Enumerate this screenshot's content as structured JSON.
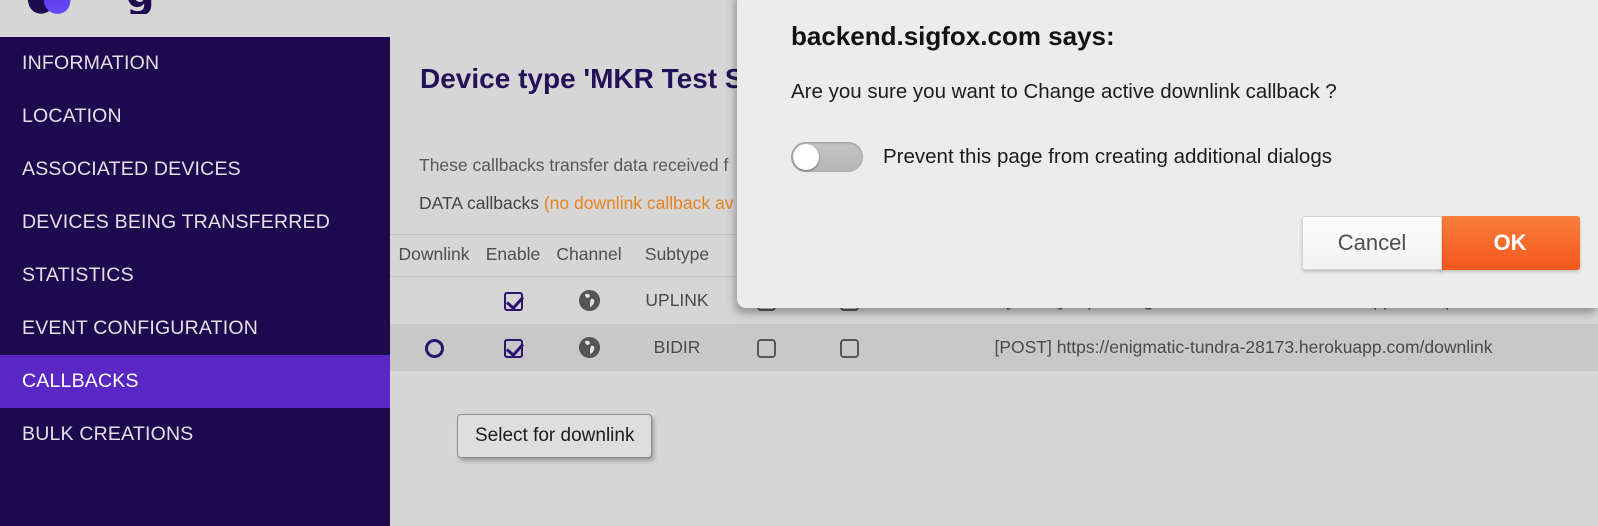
{
  "brand": {
    "logo_name": "sigfox-logo"
  },
  "sidebar": {
    "items": [
      {
        "label": "INFORMATION",
        "active": false
      },
      {
        "label": "LOCATION",
        "active": false
      },
      {
        "label": "ASSOCIATED DEVICES",
        "active": false
      },
      {
        "label": "DEVICES BEING TRANSFERRED",
        "active": false
      },
      {
        "label": "STATISTICS",
        "active": false
      },
      {
        "label": "EVENT CONFIGURATION",
        "active": false
      },
      {
        "label": "CALLBACKS",
        "active": true
      },
      {
        "label": "BULK CREATIONS",
        "active": false
      }
    ],
    "active_color": "#5b27c4",
    "background": "#1d0a4e"
  },
  "main": {
    "page_title": "Device type 'MKR Test S",
    "description_line1": "These callbacks transfer data received f",
    "description_line2_prefix": "DATA callbacks ",
    "description_line2_warning": "(no downlink callback av",
    "warning_color": "#e8831f",
    "table": {
      "headers": [
        "Downlink",
        "Enable",
        "Channel",
        "Subtype",
        "",
        "",
        ""
      ],
      "rows": [
        {
          "downlink": "",
          "downlink_type": "none",
          "enable_checked": true,
          "channel_icon": "globe-icon",
          "subtype": "UPLINK",
          "copy_checked": false,
          "edit_checked": false,
          "url": "[POST] https://enigmatic-tundra-28173.herokuapp.com/uplink",
          "highlight": false
        },
        {
          "downlink": "",
          "downlink_type": "radio",
          "enable_checked": true,
          "channel_icon": "globe-icon",
          "subtype": "BIDIR",
          "copy_checked": false,
          "edit_checked": false,
          "url": "[POST] https://enigmatic-tundra-28173.herokuapp.com/downlink",
          "highlight": true
        }
      ]
    }
  },
  "tooltip": {
    "text": "Select for downlink"
  },
  "dialog": {
    "title": "backend.sigfox.com says:",
    "message": "Are you sure you want to Change active downlink callback ?",
    "toggle_label": "Prevent this page from creating additional dialogs",
    "toggle_on": false,
    "cancel_label": "Cancel",
    "ok_label": "OK",
    "ok_color": "#f4571d"
  }
}
